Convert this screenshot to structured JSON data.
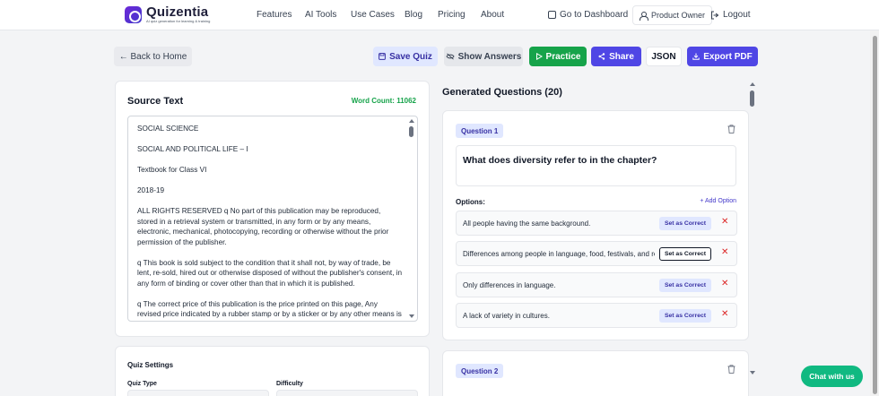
{
  "header": {
    "logo_title": "Quizentia",
    "logo_subtitle": "AI quiz generation for learning & training",
    "nav": [
      "Features",
      "AI Tools",
      "Use Cases",
      "Blog",
      "Pricing",
      "About"
    ],
    "dashboard": "Go to Dashboard",
    "user": "Product Owner",
    "logout": "Logout"
  },
  "toolbar": {
    "back": "← Back to Home",
    "save": "Save Quiz",
    "show_answers": "Show Answers",
    "practice": "Practice",
    "share": "Share",
    "json": "JSON",
    "export": "Export PDF"
  },
  "source": {
    "title": "Source Text",
    "word_count": "Word Count: 11062",
    "paragraphs": [
      "SOCIAL SCIENCE",
      "SOCIAL AND POLITICAL LIFE – I",
      "Textbook for Class VI",
      "2018-19",
      "ALL RIGHTS RESERVED q No part of this publication may be reproduced, stored in a retrieval system or transmitted, in any form or by any means, electronic, mechanical, photocopying, recording or otherwise without the prior permission of the publisher.",
      "q This book is sold subject to the condition that it shall not, by way of trade, be lent, re-sold, hired out or otherwise disposed of without the publisher's consent, in any form of binding or cover other than that in which it is published.",
      "q The correct price of this publication is the price printed on this page, Any revised price indicated by a rubber stamp or by a sticker or by any other means is"
    ]
  },
  "settings": {
    "title": "Quiz Settings",
    "quiz_type_label": "Quiz Type",
    "difficulty_label": "Difficulty"
  },
  "questions": {
    "title": "Generated Questions (20)",
    "q1": {
      "badge": "Question 1",
      "text": "What does diversity refer to in the chapter?",
      "options_label": "Options:",
      "add_option": "+ Add Option",
      "options": [
        "All people having the same background.",
        "Differences among people in language, food, festivals, and religion.",
        "Only differences in language.",
        "A lack of variety in cultures."
      ],
      "set_correct": "Set as Correct"
    },
    "q2": {
      "badge": "Question 2"
    }
  },
  "chat": "Chat with us"
}
